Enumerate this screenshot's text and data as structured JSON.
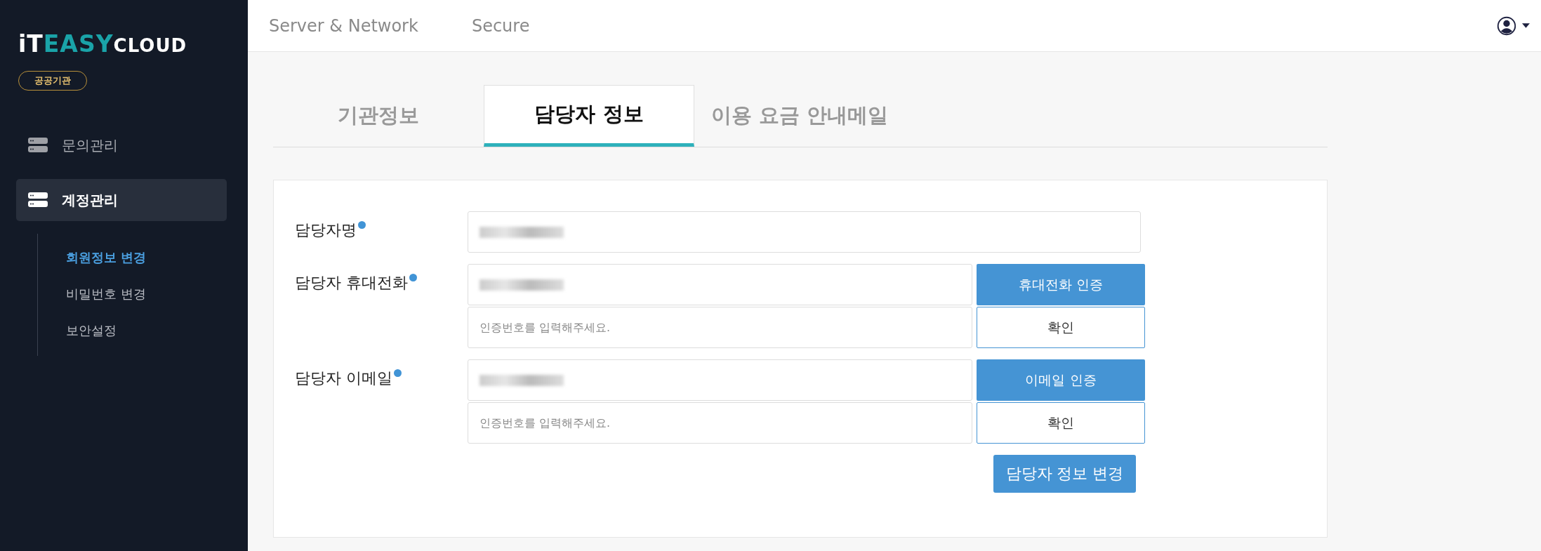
{
  "sidebar": {
    "logo": [
      {
        "text": "iT",
        "kind": "light"
      },
      {
        "text": "EASY",
        "kind": "accent"
      },
      {
        "text": "CLOUD",
        "kind": "small"
      }
    ],
    "badge": "공공기관",
    "items": [
      {
        "label": "문의관리",
        "selected": false
      },
      {
        "label": "계정관리",
        "selected": true,
        "children": [
          {
            "label": "회원정보 변경",
            "selected": true
          },
          {
            "label": "비밀번호 변경",
            "selected": false
          },
          {
            "label": "보안설정",
            "selected": false
          }
        ]
      }
    ]
  },
  "top_nav": [
    {
      "label": "Server & Network"
    },
    {
      "label": "Secure"
    }
  ],
  "tabs": [
    {
      "label": "기관정보",
      "selected": false
    },
    {
      "label": "담당자 정보",
      "selected": true
    },
    {
      "label": "이용 요금 안내메일",
      "selected": false
    }
  ],
  "form": {
    "rows": [
      {
        "label": "담당자명",
        "required": true,
        "fields": [
          {
            "value_redacted": true
          }
        ]
      },
      {
        "label": "담당자 휴대전화",
        "required": true,
        "fields": [
          {
            "value_redacted": true,
            "button": {
              "label": "휴대전화 인증",
              "kind": "primary"
            }
          },
          {
            "value_redacted": false,
            "placeholder": "인증번호를 입력해주세요.",
            "button": {
              "label": "확인",
              "kind": "outline"
            }
          }
        ]
      },
      {
        "label": "담당자 이메일",
        "required": true,
        "fields": [
          {
            "value_redacted": true,
            "button": {
              "label": "이메일 인증",
              "kind": "primary"
            }
          },
          {
            "value_redacted": false,
            "placeholder": "인증번호를 입력해주세요.",
            "button": {
              "label": "확인",
              "kind": "outline"
            }
          }
        ]
      }
    ],
    "submit": "담당자 정보 변경"
  }
}
